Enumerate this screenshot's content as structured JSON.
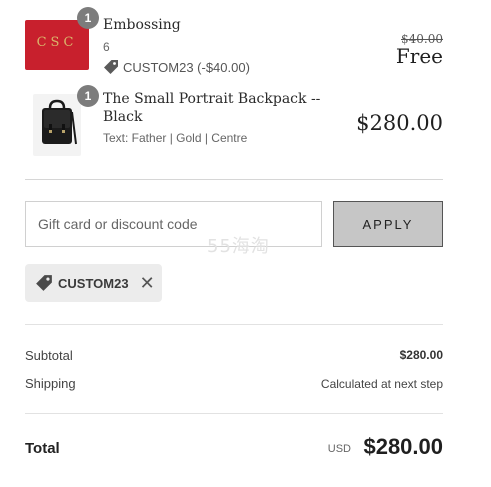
{
  "line_items": [
    {
      "quantity": "1",
      "title": "Embossing",
      "subtitle": "6",
      "monogram": "CSC",
      "discount": {
        "icon": "tag-icon",
        "text": "CUSTOM23 (-$40.00)"
      },
      "price_original": "$40.00",
      "price_final": "Free"
    },
    {
      "quantity": "1",
      "title": "The Small Portrait Backpack -- Black",
      "subtitle": "Text: Father | Gold | Centre",
      "price_final": "$280.00"
    }
  ],
  "discount_form": {
    "placeholder": "Gift card or discount code",
    "apply_label": "APPLY"
  },
  "watermark": "55海淘",
  "applied_code": {
    "icon": "tag-icon",
    "label": "CUSTOM23",
    "remove_icon": "close-icon"
  },
  "summary": {
    "subtotal_label": "Subtotal",
    "subtotal_value": "$280.00",
    "shipping_label": "Shipping",
    "shipping_value": "Calculated at next step",
    "total_label": "Total",
    "total_currency": "USD",
    "total_value": "$280.00"
  },
  "colors": {
    "badge": "#7c7c7c",
    "apply_button": "#c6c6c6",
    "chip_background": "#ececec",
    "emboss_leather": "#c8202d",
    "monogram_gold": "#d9b46a"
  }
}
